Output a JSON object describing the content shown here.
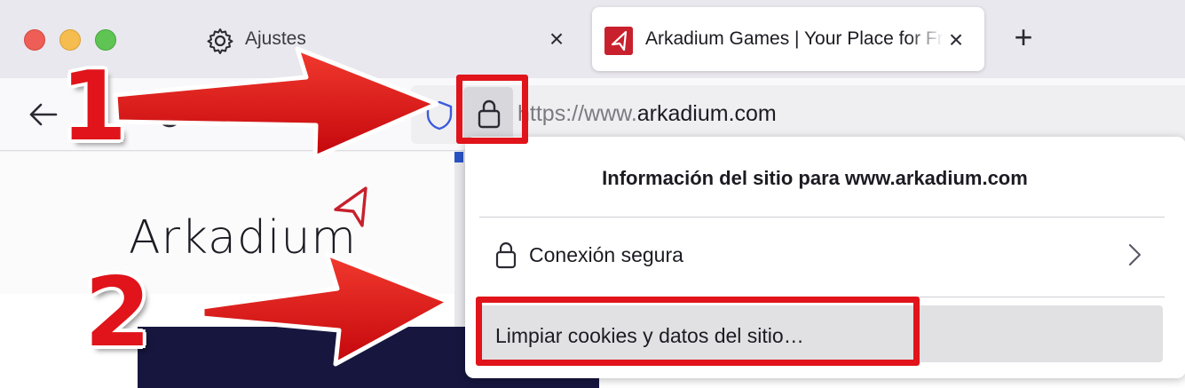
{
  "window": {
    "tabs": [
      {
        "label": "Ajustes",
        "icon": "gear-icon",
        "active": false
      },
      {
        "label": "Arkadium Games | Your Place for Free Online Games",
        "icon": "arkadium-favicon-icon",
        "active": true
      }
    ],
    "new_tab_icon": "plus-icon"
  },
  "navbar": {
    "url_prefix": "https://www.",
    "url_domain": "arkadium.com"
  },
  "page": {
    "brand": "Arkadium"
  },
  "site_panel": {
    "title": "Información del sitio para www.arkadium.com",
    "connection_label": "Conexión segura",
    "clear_label": "Limpiar cookies y datos del sitio…"
  },
  "annotations": {
    "step1": "1",
    "step2": "2",
    "color": "#e0141a"
  }
}
